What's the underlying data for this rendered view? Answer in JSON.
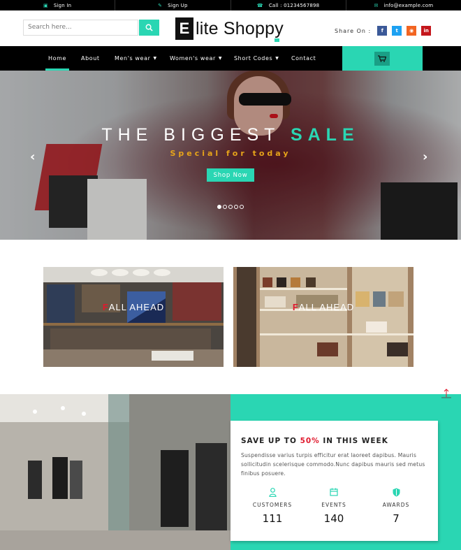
{
  "topbar": {
    "items": [
      {
        "icon": "lock-icon",
        "label": "Sign In"
      },
      {
        "icon": "edit-icon",
        "label": "Sign Up"
      },
      {
        "icon": "phone-icon",
        "label": "Call : 01234567898"
      },
      {
        "icon": "envelope-icon",
        "label": "info@example.com"
      }
    ]
  },
  "header": {
    "search_placeholder": "Search here...",
    "logo_letter": "E",
    "logo_text": "lite Shoppy",
    "share_label": "Share On :",
    "share_buttons": [
      {
        "icon": "facebook-icon",
        "glyph": "f",
        "color": "#3b5998"
      },
      {
        "icon": "twitter-icon",
        "glyph": "t",
        "color": "#1da1f2"
      },
      {
        "icon": "rss-icon",
        "glyph": "◉",
        "color": "#f26522"
      },
      {
        "icon": "linkedin-icon",
        "glyph": "in",
        "color": "#c4161c"
      }
    ]
  },
  "nav": {
    "items": [
      {
        "label": "Home",
        "active": true
      },
      {
        "label": "About",
        "active": false
      },
      {
        "label": "Men's wear",
        "dropdown": true
      },
      {
        "label": "Women's wear",
        "dropdown": true
      },
      {
        "label": "Short Codes",
        "dropdown": true
      },
      {
        "label": "Contact",
        "active": false
      }
    ]
  },
  "hero": {
    "title_main": "THE BIGGEST ",
    "title_accent": "SALE",
    "subtitle": "Special for today",
    "button": "Shop Now",
    "slides": 5,
    "current_slide": 1
  },
  "banners": [
    {
      "first_letter": "F",
      "rest": "ALL AHEAD"
    },
    {
      "first_letter": "F",
      "rest": "ALL AHEAD"
    }
  ],
  "promo": {
    "title_before": "SAVE UP TO ",
    "title_pct": "50%",
    "title_after": " IN THIS WEEK",
    "text": "Suspendisse varius turpis efficitur erat laoreet dapibus. Mauris sollicitudin scelerisque commodo.Nunc dapibus mauris sed metus finibus posuere.",
    "stats": [
      {
        "icon": "user-icon",
        "label": "CUSTOMERS",
        "value": "111"
      },
      {
        "icon": "calendar-icon",
        "label": "EVENTS",
        "value": "140"
      },
      {
        "icon": "shield-icon",
        "label": "AWARDS",
        "value": "7"
      }
    ]
  },
  "colors": {
    "accent": "#2ad6b3",
    "red": "#e0192d",
    "gold": "#e7a41a"
  }
}
